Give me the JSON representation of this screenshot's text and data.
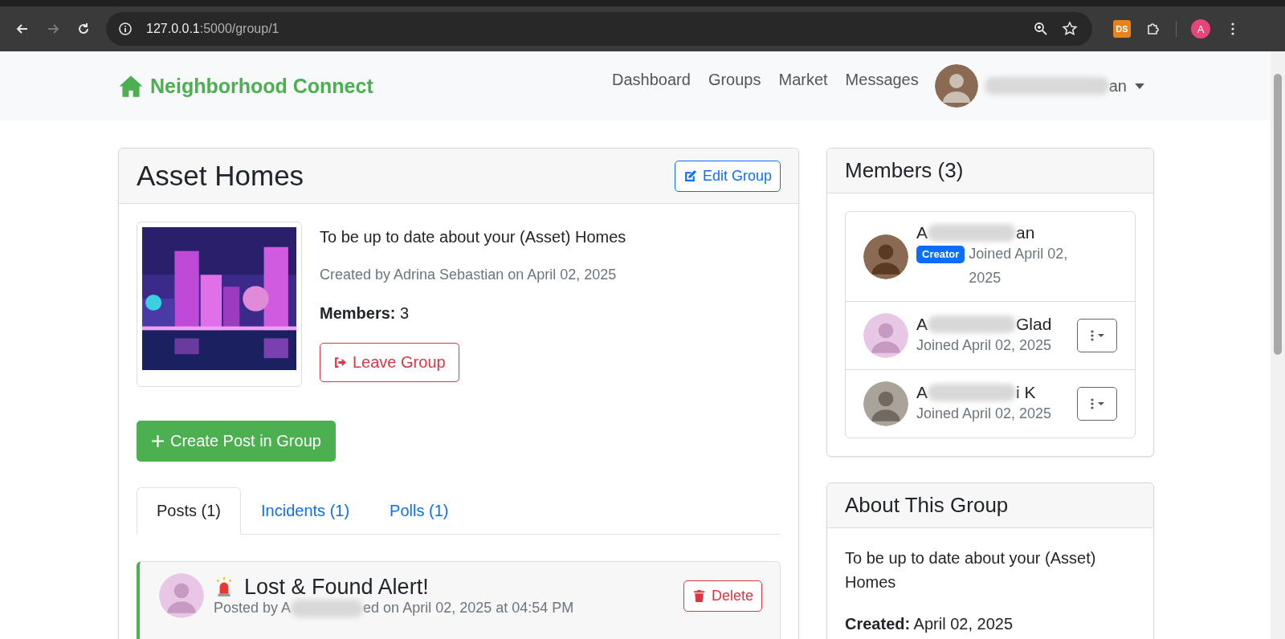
{
  "browser": {
    "url_host": "127.0.0.1",
    "url_path": ":5000/group/1",
    "extension_label": "DS",
    "profile_initial": "A"
  },
  "navbar": {
    "brand": "Neighborhood Connect",
    "links": [
      "Dashboard",
      "Groups",
      "Market",
      "Messages"
    ],
    "user_name_end": "an"
  },
  "group": {
    "title": "Asset Homes",
    "edit_button": "Edit Group",
    "description": "To be up to date about your (Asset) Homes",
    "created_by": "Created by Adrina Sebastian on April 02, 2025",
    "members_line": "**Members:** 3",
    "leave_button": "Leave Group",
    "create_post_button": "Create Post in Group"
  },
  "tabs": [
    {
      "label": "Posts (1)",
      "selected": true
    },
    {
      "label": "Incidents (1)",
      "selected": false
    },
    {
      "label": "Polls (1)",
      "selected": false
    }
  ],
  "post": {
    "title": "Lost & Found Alert!",
    "meta_start": "Posted by A",
    "meta_end": "ed on April 02, 2025 at 04:54 PM",
    "delete_button": "Delete"
  },
  "members_panel": {
    "title": "Members (3)",
    "members": [
      {
        "name_start": "A",
        "name_end": "an",
        "badge": "Creator",
        "joined": "Joined April 02, 2025",
        "menu": false
      },
      {
        "name_start": "A",
        "name_end": "Glad",
        "joined": "Joined April 02, 2025",
        "menu": true
      },
      {
        "name_start": "A",
        "name_end": "i K",
        "joined": "Joined April 02, 2025",
        "menu": true
      }
    ]
  },
  "about": {
    "title": "About This Group",
    "description": "To be up to date about your (Asset) Homes",
    "created_line": "**Created:** April 02, 2025"
  }
}
